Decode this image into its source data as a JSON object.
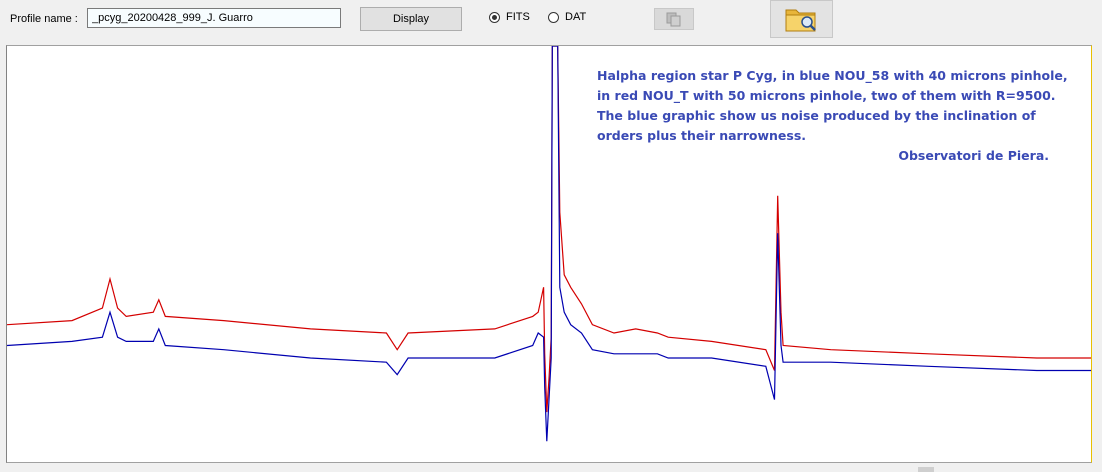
{
  "toolbar": {
    "profile_label": "Profile name :",
    "profile_value": "_pcyg_20200428_999_J. Guarro",
    "display_label": "Display",
    "format_options": [
      {
        "label": "FITS",
        "selected": true
      },
      {
        "label": "DAT",
        "selected": false
      }
    ],
    "copy_icon": "copy-icon",
    "open_icon": "folder-search-icon"
  },
  "annotation": {
    "lines": [
      "Halpha region star P Cyg, in blue NOU_58 with 40 microns pinhole,",
      "in red NOU_T with 50 microns pinhole, two of them with R=9500.",
      "The blue graphic show us noise produced by the inclination of",
      "orders plus their narrowness."
    ],
    "signature": "Observatori de Piera.",
    "color": "#3a4ab5"
  },
  "chart_data": {
    "type": "line",
    "xlim": [
      0,
      1000
    ],
    "ylim": [
      0,
      1
    ],
    "grid": false,
    "series": [
      {
        "color": "#d40000",
        "points": [
          [
            0,
            0.33
          ],
          [
            60,
            0.34
          ],
          [
            88,
            0.37
          ],
          [
            95,
            0.44
          ],
          [
            102,
            0.37
          ],
          [
            110,
            0.35
          ],
          [
            135,
            0.36
          ],
          [
            140,
            0.39
          ],
          [
            146,
            0.35
          ],
          [
            200,
            0.34
          ],
          [
            280,
            0.32
          ],
          [
            350,
            0.31
          ],
          [
            360,
            0.27
          ],
          [
            370,
            0.31
          ],
          [
            450,
            0.32
          ],
          [
            485,
            0.35
          ],
          [
            490,
            0.36
          ],
          [
            495,
            0.42
          ],
          [
            496,
            0.26
          ],
          [
            498,
            0.12
          ],
          [
            500,
            0.2
          ],
          [
            502,
            0.3
          ],
          [
            503,
            1.0
          ],
          [
            508,
            1.0
          ],
          [
            510,
            0.6
          ],
          [
            514,
            0.45
          ],
          [
            520,
            0.42
          ],
          [
            530,
            0.38
          ],
          [
            540,
            0.33
          ],
          [
            560,
            0.31
          ],
          [
            580,
            0.32
          ],
          [
            600,
            0.31
          ],
          [
            610,
            0.3
          ],
          [
            650,
            0.29
          ],
          [
            700,
            0.27
          ],
          [
            708,
            0.22
          ],
          [
            711,
            0.64
          ],
          [
            714,
            0.36
          ],
          [
            716,
            0.28
          ],
          [
            760,
            0.27
          ],
          [
            850,
            0.26
          ],
          [
            950,
            0.25
          ],
          [
            1000,
            0.25
          ]
        ]
      },
      {
        "color": "#0000b0",
        "points": [
          [
            0,
            0.28
          ],
          [
            60,
            0.29
          ],
          [
            88,
            0.3
          ],
          [
            95,
            0.36
          ],
          [
            102,
            0.3
          ],
          [
            110,
            0.29
          ],
          [
            135,
            0.29
          ],
          [
            140,
            0.32
          ],
          [
            146,
            0.28
          ],
          [
            200,
            0.27
          ],
          [
            280,
            0.25
          ],
          [
            350,
            0.24
          ],
          [
            360,
            0.21
          ],
          [
            370,
            0.25
          ],
          [
            450,
            0.25
          ],
          [
            485,
            0.28
          ],
          [
            490,
            0.31
          ],
          [
            495,
            0.3
          ],
          [
            496,
            0.18
          ],
          [
            498,
            0.05
          ],
          [
            500,
            0.15
          ],
          [
            502,
            0.25
          ],
          [
            503,
            1.0
          ],
          [
            508,
            1.0
          ],
          [
            510,
            0.42
          ],
          [
            514,
            0.36
          ],
          [
            520,
            0.33
          ],
          [
            530,
            0.31
          ],
          [
            540,
            0.27
          ],
          [
            560,
            0.26
          ],
          [
            580,
            0.26
          ],
          [
            600,
            0.26
          ],
          [
            610,
            0.25
          ],
          [
            650,
            0.25
          ],
          [
            700,
            0.23
          ],
          [
            708,
            0.15
          ],
          [
            711,
            0.55
          ],
          [
            714,
            0.28
          ],
          [
            716,
            0.24
          ],
          [
            760,
            0.24
          ],
          [
            850,
            0.23
          ],
          [
            950,
            0.22
          ],
          [
            1000,
            0.22
          ]
        ]
      }
    ]
  }
}
